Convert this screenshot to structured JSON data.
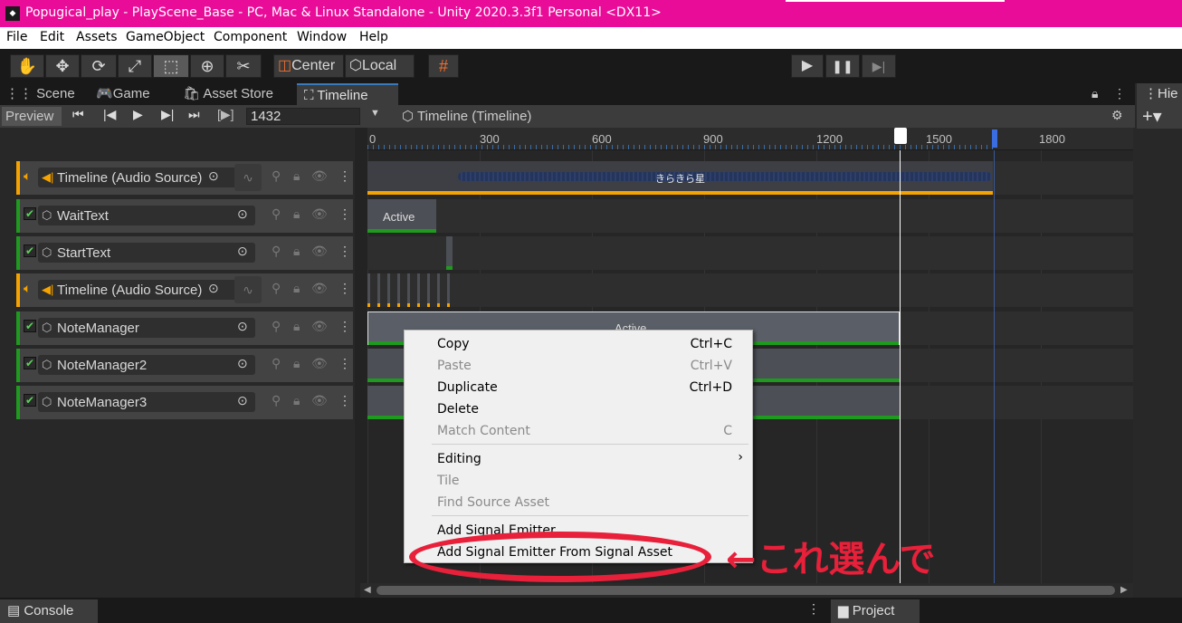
{
  "window": {
    "title": "Popugical_play - PlayScene_Base - PC, Mac & Linux Standalone - Unity 2020.3.3f1 Personal <DX11>"
  },
  "menu": [
    "File",
    "Edit",
    "Assets",
    "GameObject",
    "Component",
    "Window",
    "Help"
  ],
  "toolbar": {
    "center_label": "Center",
    "local_label": "Local"
  },
  "tabs": [
    "Scene",
    "Game",
    "Asset Store",
    "Timeline"
  ],
  "right_panel": {
    "tab": "Hie"
  },
  "timeline": {
    "preview_label": "Preview",
    "frame": "1432",
    "asset": "Timeline (Timeline)",
    "ruler": [
      "0",
      "300",
      "600",
      "900",
      "1200",
      "1500",
      "1800"
    ]
  },
  "tracks": [
    {
      "name": "Timeline (Audio Source)",
      "type": "audio"
    },
    {
      "name": "WaitText",
      "type": "activation"
    },
    {
      "name": "StartText",
      "type": "activation"
    },
    {
      "name": "Timeline (Audio Source)",
      "type": "audio"
    },
    {
      "name": "NoteManager",
      "type": "activation"
    },
    {
      "name": "NoteManager2",
      "type": "activation"
    },
    {
      "name": "NoteManager3",
      "type": "activation"
    }
  ],
  "clips": {
    "audio1": "きらきら星",
    "wait": "Active",
    "note": "Active"
  },
  "context_menu": {
    "items": [
      {
        "label": "Copy",
        "shortcut": "Ctrl+C"
      },
      {
        "label": "Paste",
        "shortcut": "Ctrl+V"
      },
      {
        "label": "Duplicate",
        "shortcut": "Ctrl+D"
      },
      {
        "label": "Delete",
        "shortcut": ""
      },
      {
        "label": "Match Content",
        "shortcut": "C"
      },
      {
        "label": "Editing",
        "shortcut": "›"
      },
      {
        "label": "Tile",
        "shortcut": ""
      },
      {
        "label": "Find Source Asset",
        "shortcut": ""
      },
      {
        "label": "Add Signal Emitter",
        "shortcut": ""
      },
      {
        "label": "Add Signal Emitter From Signal Asset",
        "shortcut": ""
      }
    ]
  },
  "annotation": {
    "text": "←これ選んで",
    "color": "#e8203a"
  },
  "bottom": {
    "console": "Console",
    "project": "Project"
  }
}
